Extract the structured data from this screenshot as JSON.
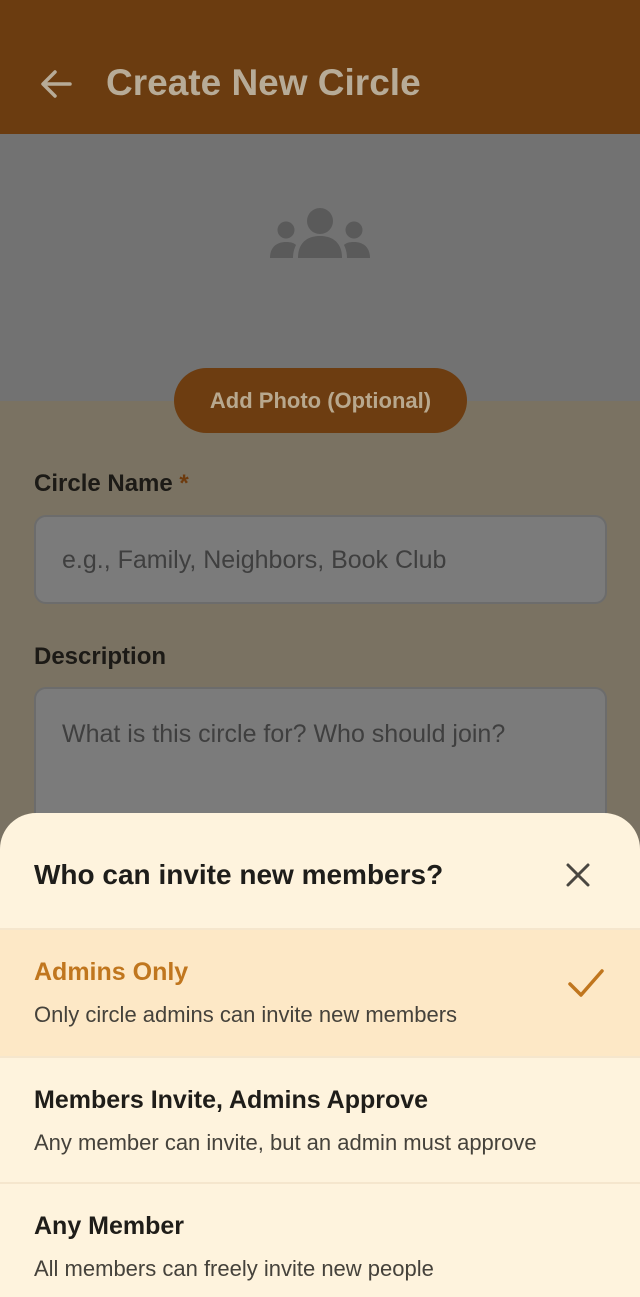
{
  "header": {
    "title": "Create New Circle",
    "back_icon": "arrow-left-icon"
  },
  "cover": {
    "icon": "group-icon",
    "add_photo_label": "Add Photo (Optional)"
  },
  "form": {
    "name_label": "Circle Name",
    "required_marker": "*",
    "name_placeholder": "e.g., Family, Neighbors, Book Club",
    "description_label": "Description",
    "description_placeholder": "What is this circle for? Who should join?"
  },
  "sheet": {
    "title": "Who can invite new members?",
    "close_icon": "close-icon",
    "options": [
      {
        "title": "Admins Only",
        "description": "Only circle admins can invite new members",
        "selected": true
      },
      {
        "title": "Members Invite, Admins Approve",
        "description": "Any member can invite, but an admin must approve",
        "selected": false
      },
      {
        "title": "Any Member",
        "description": "All members can freely invite new people",
        "selected": false
      }
    ]
  },
  "colors": {
    "app_bar": "#6b3c10",
    "sheet_background": "#fef3dd",
    "selected_background": "#fde8c6",
    "accent": "#c0761e"
  }
}
